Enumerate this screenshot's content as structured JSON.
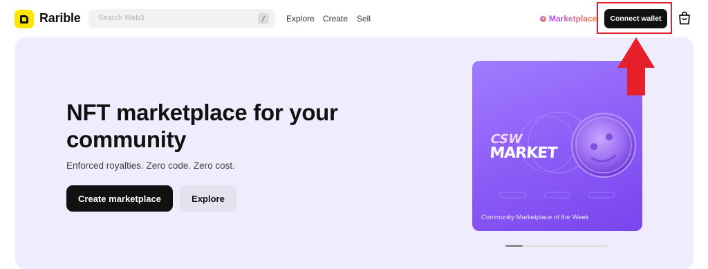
{
  "header": {
    "brand": "Rarible",
    "search": {
      "placeholder": "Search Web3",
      "shortcut": "/"
    },
    "nav": [
      "Explore",
      "Create",
      "Sell"
    ],
    "marketplace_link": "Marketplace",
    "connect_wallet": "Connect wallet",
    "icons": {
      "logo": "rarible-logo-icon",
      "marketplace": "marketplace-dot-icon",
      "cart": "shopping-bag-icon"
    }
  },
  "hero": {
    "title": "NFT marketplace for your community",
    "subtitle": "Enforced royalties. Zero code. Zero cost.",
    "primary_button": "Create marketplace",
    "secondary_button": "Explore"
  },
  "card": {
    "logo_top": "CSW",
    "logo_bottom": "MARKET",
    "caption": "Community Marketplace of the Week",
    "carousel": {
      "current": 1,
      "total": 6
    }
  },
  "annotation": {
    "highlight_color": "#e5202a"
  },
  "colors": {
    "brand_yellow": "#FFE600",
    "accent_purple": "#8b5bf6",
    "hero_bg": "#efedfd"
  }
}
